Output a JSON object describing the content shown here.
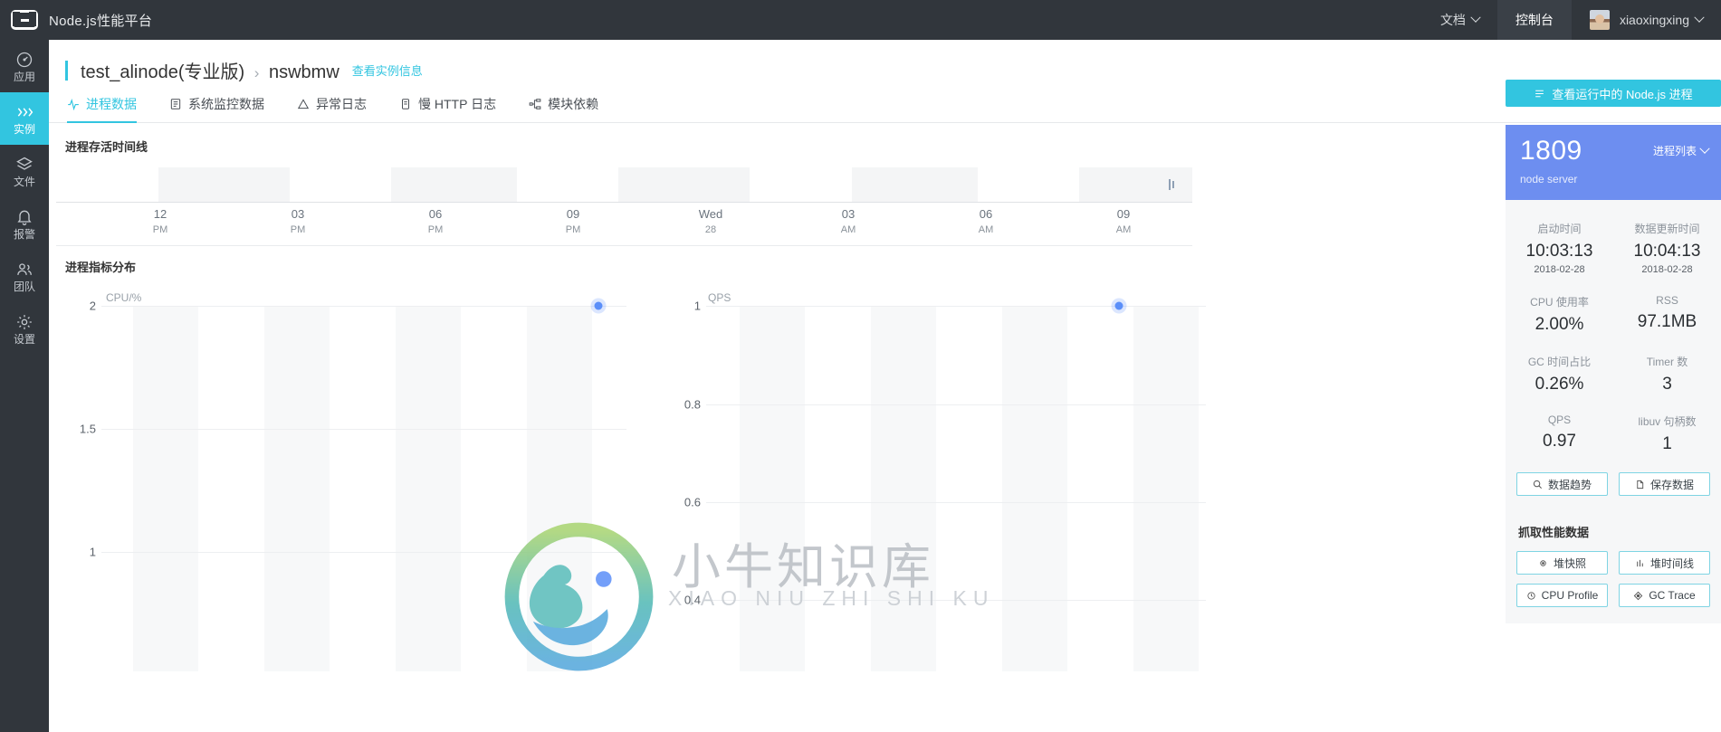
{
  "topbar": {
    "app_title": "Node.js性能平台",
    "logo_icon": "node-brackets-logo",
    "docs_label": "文档",
    "console_label": "控制台",
    "user_name": "xiaoxingxing",
    "chevron_icon": "chevron-down-icon"
  },
  "sidebar": {
    "items": [
      {
        "label": "应用",
        "icon": "gauge-icon",
        "active": false
      },
      {
        "label": "实例",
        "icon": "chevrons-right-icon",
        "active": true
      },
      {
        "label": "文件",
        "icon": "layers-icon",
        "active": false
      },
      {
        "label": "报警",
        "icon": "bell-icon",
        "active": false
      },
      {
        "label": "团队",
        "icon": "users-icon",
        "active": false
      },
      {
        "label": "设置",
        "icon": "gear-icon",
        "active": false
      }
    ]
  },
  "breadcrumb": {
    "app_name": "test_alinode(专业版)",
    "separator": "›",
    "instance_name": "nswbmw",
    "info_link": "查看实例信息"
  },
  "tabs": [
    {
      "label": "进程数据",
      "icon": "pulse-icon",
      "active": true
    },
    {
      "label": "系统监控数据",
      "icon": "list-icon",
      "active": false
    },
    {
      "label": "异常日志",
      "icon": "warning-triangle-icon",
      "active": false
    },
    {
      "label": "慢 HTTP 日志",
      "icon": "document-icon",
      "active": false
    },
    {
      "label": "模块依赖",
      "icon": "tree-icon",
      "active": false
    }
  ],
  "timeline": {
    "title": "进程存活时间线",
    "handle_icon": "resize-handle-icon"
  },
  "metrics": {
    "title": "进程指标分布",
    "watermark_text": "小牛知识库",
    "watermark_sub": "XIAO NIU ZHI SHI KU"
  },
  "right_panel": {
    "view_processes_label": "查看运行中的 Node.js 进程",
    "view_processes_icon": "list-icon",
    "pid": "1809",
    "process_name": "node server",
    "process_list_label": "进程列表",
    "stats": [
      {
        "label": "启动时间",
        "value": "10:03:13",
        "sub": "2018-02-28"
      },
      {
        "label": "数据更新时间",
        "value": "10:04:13",
        "sub": "2018-02-28"
      },
      {
        "label": "CPU 使用率",
        "value": "2.00%",
        "sub": ""
      },
      {
        "label": "RSS",
        "value": "97.1MB",
        "sub": ""
      },
      {
        "label": "GC 时间占比",
        "value": "0.26%",
        "sub": ""
      },
      {
        "label": "Timer 数",
        "value": "3",
        "sub": ""
      },
      {
        "label": "QPS",
        "value": "0.97",
        "sub": ""
      },
      {
        "label": "libuv 句柄数",
        "value": "1",
        "sub": ""
      }
    ],
    "actions": [
      {
        "label": "数据趋势",
        "icon": "search-icon"
      },
      {
        "label": "保存数据",
        "icon": "file-icon"
      }
    ],
    "capture_title": "抓取性能数据",
    "capture_actions": [
      {
        "label": "堆快照",
        "icon": "camera-icon"
      },
      {
        "label": "堆时间线",
        "icon": "bars-icon"
      },
      {
        "label": "CPU Profile",
        "icon": "clock-icon"
      },
      {
        "label": "GC Trace",
        "icon": "target-icon"
      }
    ]
  },
  "chart_data": [
    {
      "type": "area",
      "name": "process-alive-timeline",
      "title": "进程存活时间线",
      "xlabel": "",
      "ylabel": "",
      "grid": false,
      "xticks": [
        {
          "main": "12",
          "sub": "PM"
        },
        {
          "main": "03",
          "sub": "PM"
        },
        {
          "main": "06",
          "sub": "PM"
        },
        {
          "main": "09",
          "sub": "PM"
        },
        {
          "main": "Wed",
          "sub": "28"
        },
        {
          "main": "03",
          "sub": "AM"
        },
        {
          "main": "06",
          "sub": "AM"
        },
        {
          "main": "09",
          "sub": "AM"
        }
      ],
      "bands": [
        {
          "start_pct": 9.0,
          "end_pct": 20.5
        },
        {
          "start_pct": 29.5,
          "end_pct": 40.5
        },
        {
          "start_pct": 49.5,
          "end_pct": 61.0
        },
        {
          "start_pct": 70.0,
          "end_pct": 81.0
        },
        {
          "start_pct": 90.0,
          "end_pct": 100.0
        }
      ]
    },
    {
      "type": "scatter",
      "name": "cpu-distribution",
      "title": "进程指标分布",
      "ylabel": "CPU/%",
      "xlabel": "",
      "ylim": [
        0.75,
        2.0
      ],
      "yticks": [
        2.0,
        1.5,
        1.0
      ],
      "grid": true,
      "points": [
        {
          "x_pct": 94.0,
          "y": 2.0
        }
      ]
    },
    {
      "type": "scatter",
      "name": "qps-distribution",
      "title": "",
      "ylabel": "QPS",
      "xlabel": "",
      "ylim": [
        0.32,
        1.05
      ],
      "yticks": [
        1.0,
        0.8,
        0.6,
        0.4
      ],
      "grid": true,
      "points": [
        {
          "x_pct": 87.0,
          "y": 1.0
        }
      ]
    }
  ]
}
